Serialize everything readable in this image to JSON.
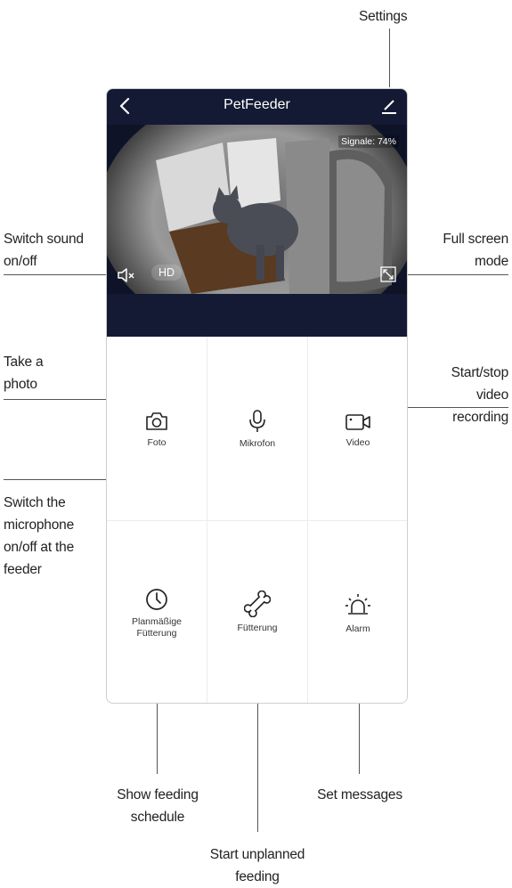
{
  "annotations": {
    "settings": "Settings",
    "switch_sound": [
      "Switch sound",
      "on/off"
    ],
    "full_screen": [
      "Full screen",
      "mode"
    ],
    "take_photo": [
      "Take a",
      "photo"
    ],
    "start_stop_video": [
      "Start/stop",
      "video",
      "recording"
    ],
    "switch_microphone": [
      "Switch the",
      "microphone",
      "on/off at the",
      "feeder"
    ],
    "show_schedule": [
      "Show feeding",
      "schedule"
    ],
    "set_messages": "Set messages",
    "start_unplanned": [
      "Start unplanned",
      "feeding"
    ]
  },
  "app": {
    "title": "PetFeeder",
    "signal": "Signale: 74%",
    "hd_label": "HD"
  },
  "buttons": {
    "foto": "Foto",
    "mikrofon": "Mikrofon",
    "video": "Video",
    "schedule": [
      "Planmäßige",
      "Fütterung"
    ],
    "fuetterung": "Fütterung",
    "alarm": "Alarm"
  },
  "icons": {
    "back": "chevron-left-icon",
    "edit": "pencil-icon",
    "mute": "speaker-mute-icon",
    "fullscreen": "expand-icon",
    "camera": "camera-icon",
    "mic": "microphone-icon",
    "video": "video-camera-icon",
    "clock": "clock-icon",
    "bone": "bone-icon",
    "alarm": "alarm-light-icon"
  },
  "colors": {
    "header_bg": "#141a33",
    "divider": "#ececec"
  }
}
